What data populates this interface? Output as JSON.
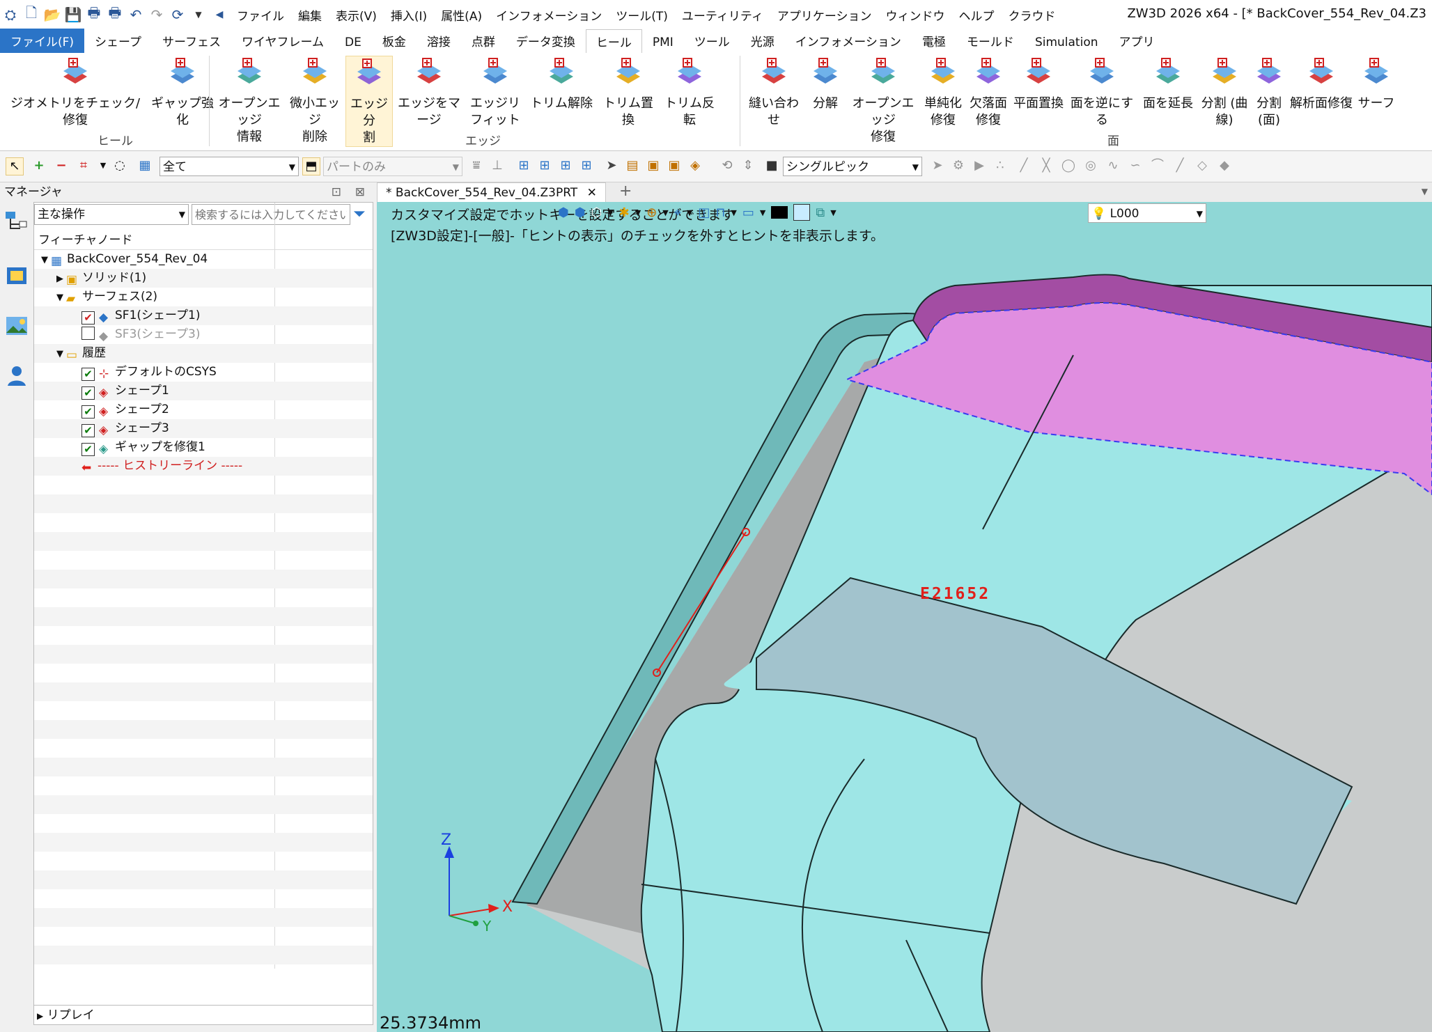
{
  "app": {
    "title": "ZW3D 2026 x64  - [* BackCover_554_Rev_04.Z3"
  },
  "menubar": [
    "ファイル",
    "編集",
    "表示(V)",
    "挿入(I)",
    "属性(A)",
    "インフォメーション",
    "ツール(T)",
    "ユーティリティ",
    "アプリケーション",
    "ウィンドウ",
    "ヘルプ",
    "クラウド"
  ],
  "tabs": [
    "ファイル(F)",
    "シェープ",
    "サーフェス",
    "ワイヤフレーム",
    "DE",
    "板金",
    "溶接",
    "点群",
    "データ変換",
    "ヒール",
    "PMI",
    "ツール",
    "光源",
    "インフォメーション",
    "電極",
    "モールド",
    "Simulation",
    "アプリ"
  ],
  "active_tab": "ヒール",
  "ribbon": {
    "groups": [
      {
        "label": "ヒール",
        "buttons": [
          {
            "l1": "ジオメトリをチェック/修復",
            "l2": "",
            "icon": "check-repair-icon"
          },
          {
            "l1": "ギャップ強化",
            "l2": "",
            "icon": "gap-strengthen-icon"
          }
        ]
      },
      {
        "label": "エッジ",
        "buttons": [
          {
            "l1": "オープンエッジ",
            "l2": "情報",
            "icon": "open-edge-info-icon"
          },
          {
            "l1": "微小エッジ",
            "l2": "削除",
            "icon": "small-edge-delete-icon"
          },
          {
            "l1": "エッジ 分",
            "l2": "割",
            "icon": "edge-split-icon",
            "highlight": true
          },
          {
            "l1": "エッジをマージ",
            "l2": "",
            "icon": "edge-merge-icon"
          },
          {
            "l1": "エッジリ",
            "l2": "フィット",
            "icon": "edge-refit-icon"
          },
          {
            "l1": "トリム解除",
            "l2": "",
            "icon": "untrim-icon"
          },
          {
            "l1": "トリム置換",
            "l2": "",
            "icon": "trim-replace-icon"
          },
          {
            "l1": "トリム反転",
            "l2": "",
            "icon": "trim-reverse-icon"
          }
        ]
      },
      {
        "label": "面",
        "buttons": [
          {
            "l1": "縫い合わせ",
            "l2": "",
            "icon": "sew-icon"
          },
          {
            "l1": "分解",
            "l2": "",
            "icon": "explode-icon"
          },
          {
            "l1": "オープンエッジ",
            "l2": "修復",
            "icon": "open-edge-repair-icon"
          },
          {
            "l1": "単純化",
            "l2": "修復",
            "icon": "simplify-repair-icon"
          },
          {
            "l1": "欠落面",
            "l2": "修復",
            "icon": "missing-face-repair-icon"
          },
          {
            "l1": "平面置換",
            "l2": "",
            "icon": "plane-replace-icon"
          },
          {
            "l1": "面を逆にする",
            "l2": "",
            "icon": "reverse-face-icon"
          },
          {
            "l1": "面を延長",
            "l2": "",
            "icon": "extend-face-icon"
          },
          {
            "l1": "分割 (曲",
            "l2": "線)",
            "icon": "split-curve-icon"
          },
          {
            "l1": "分割",
            "l2": "(面)",
            "icon": "split-face-icon"
          },
          {
            "l1": "解析面修復",
            "l2": "",
            "icon": "analytic-face-repair-icon"
          },
          {
            "l1": "サーフ",
            "l2": "",
            "icon": "surface-icon"
          }
        ]
      }
    ]
  },
  "toolbar": {
    "filter_value": "全て",
    "part_scope": "パートのみ",
    "pick_mode": "シングルピック"
  },
  "manager": {
    "title": "マネージャ",
    "operation_select": "主な操作",
    "search_placeholder": "検索するには入力してください",
    "column_header": "フィーチャノード",
    "tree": [
      {
        "label": "BackCover_554_Rev_04",
        "indent": 0,
        "chevron": "down",
        "checkbox": "none",
        "icon": "part-icon"
      },
      {
        "label": "ソリッド(1)",
        "indent": 1,
        "chevron": "right",
        "checkbox": "none",
        "icon": "solid-icon"
      },
      {
        "label": "サーフェス(2)",
        "indent": 1,
        "chevron": "down",
        "checkbox": "none",
        "icon": "surface-group-icon"
      },
      {
        "label": "SF1(シェープ1)",
        "indent": 2,
        "chevron": "none",
        "checkbox": "checked-red",
        "icon": "surface-icon"
      },
      {
        "label": "SF3(シェープ3)",
        "indent": 2,
        "chevron": "none",
        "checkbox": "unchecked",
        "icon": "surface-grey-icon",
        "dim": true
      },
      {
        "label": "履歴",
        "indent": 1,
        "chevron": "down",
        "checkbox": "none",
        "icon": "folder-icon"
      },
      {
        "label": "デフォルトのCSYS",
        "indent": 2,
        "chevron": "none",
        "checkbox": "checked",
        "icon": "csys-icon"
      },
      {
        "label": "シェープ1",
        "indent": 2,
        "chevron": "none",
        "checkbox": "checked",
        "icon": "shape-icon"
      },
      {
        "label": "シェープ2",
        "indent": 2,
        "chevron": "none",
        "checkbox": "checked",
        "icon": "shape-icon"
      },
      {
        "label": "シェープ3",
        "indent": 2,
        "chevron": "none",
        "checkbox": "checked",
        "icon": "shape-icon"
      },
      {
        "label": "ギャップを修復1",
        "indent": 2,
        "chevron": "none",
        "checkbox": "checked",
        "icon": "gap-repair-icon"
      },
      {
        "label": "----- ヒストリーライン -----",
        "indent": 2,
        "chevron": "none",
        "checkbox": "none",
        "icon": "history-line-arrow-icon",
        "red": true
      }
    ],
    "replay_label": "リプレイ"
  },
  "document": {
    "tab_label": "* BackCover_554_Rev_04.Z3PRT",
    "hint_line1": "カスタマイズ設定でホットキーを設定することができます",
    "hint_line2": "[ZW3D設定]-[一般]-「ヒントの表示」のチェックを外すとヒントを非表示します。",
    "layer_value": "L000",
    "edge_label": "E21652",
    "measure_readout": "25.3734mm",
    "axis_labels": {
      "z": "Z",
      "x": "X",
      "y": "Y"
    }
  },
  "colors": {
    "viewport_bg": "#8fd7d6",
    "model_face": "#9ee6e6",
    "selected_face": "#e08ee0",
    "highlight_face": "#a2c3cd",
    "edge_marker": "#e0201b",
    "ribbon_accent": "#2b74c7"
  }
}
